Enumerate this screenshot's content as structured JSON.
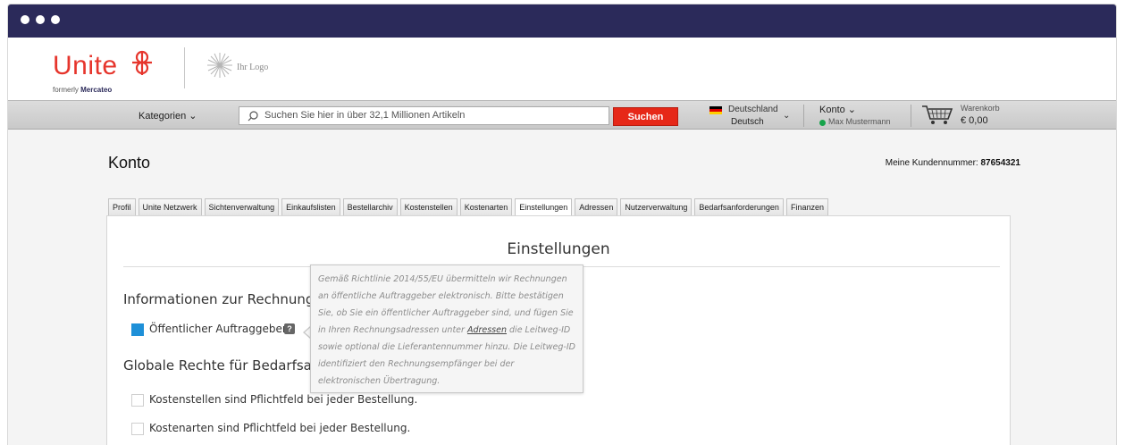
{
  "header": {
    "brand": "Unite",
    "formerly_prefix": "formerly ",
    "formerly_name": "Mercateo",
    "placeholder_logo": "Ihr Logo"
  },
  "navbar": {
    "kategorien": "Kategorien ⌄",
    "search_text": "Suchen Sie hier in über 32,1 Millionen Artikeln",
    "search_button": "Suchen",
    "country": "Deutschland",
    "language": "Deutsch",
    "konto": "Konto ⌄",
    "user": "Max Mustermann",
    "cart_label": "Warenkorb",
    "cart_amount": "€ 0,00"
  },
  "page": {
    "title": "Konto",
    "customer_label": "Meine Kundennummer: ",
    "customer_number": "87654321"
  },
  "tabs": [
    {
      "label": "Profil"
    },
    {
      "label": "Unite Netzwerk"
    },
    {
      "label": "Sichtenverwaltung"
    },
    {
      "label": "Einkaufslisten"
    },
    {
      "label": "Bestellarchiv"
    },
    {
      "label": "Kostenstellen"
    },
    {
      "label": "Kostenarten"
    },
    {
      "label": "Einstellungen",
      "active": true
    },
    {
      "label": "Adressen"
    },
    {
      "label": "Nutzerverwaltung"
    },
    {
      "label": "Bedarfsanforderungen"
    },
    {
      "label": "Finanzen"
    }
  ],
  "settings": {
    "title": "Einstellungen",
    "section1": "Informationen zur Rechnung",
    "public_client_label": "Öffentlicher Auftraggeber",
    "public_client_checked": true,
    "help_glyph": "?",
    "section2": "Globale Rechte für Bedarfsa",
    "cost_centers_label": "Kostenstellen sind Pflichtfeld bei jeder Bestellung.",
    "cost_types_label": "Kostenarten sind Pflichtfeld bei jeder Bestellung."
  },
  "tooltip": {
    "text_before": "Gemäß Richtlinie 2014/55/EU übermitteln wir Rechnungen an öffentliche Auftraggeber elektronisch. Bitte bestätigen Sie, ob Sie ein öffentlicher Auftraggeber sind, und fügen Sie in Ihren Rechnungsadressen unter ",
    "link": "Adressen",
    "text_after": " die Leitweg-ID sowie optional die Lieferantennummer hinzu. Die Leitweg-ID identifiziert den Rechnungsempfänger bei der elektronischen Übertragung."
  },
  "colors": {
    "titlebar": "#2b2a5a",
    "brand_red": "#e6352c",
    "search_button": "#e62818",
    "checkbox_checked": "#1e90d8",
    "online_dot": "#16a34a"
  },
  "icons": [
    "window-dot",
    "unite-mark-icon",
    "ihr-logo-icon",
    "search-icon",
    "germany-flag-icon",
    "chevron-down-icon",
    "cart-icon",
    "help-icon"
  ]
}
